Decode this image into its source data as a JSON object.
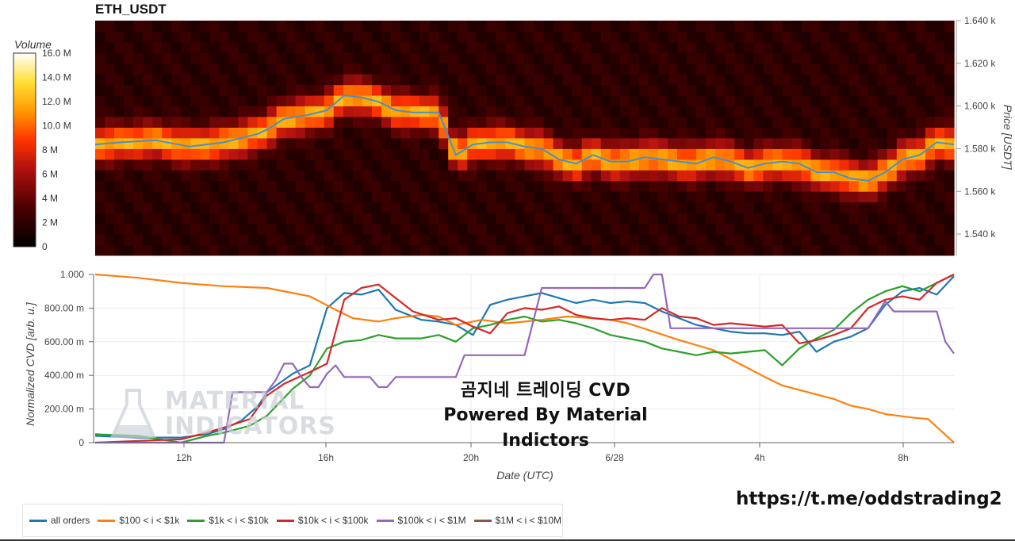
{
  "title": "ETH_USDT",
  "overlay": {
    "line1": "곰지네 트레이딩 CVD",
    "line2": "Powered By Material Indictors"
  },
  "link": "https://t.me/oddstrading2",
  "watermark": {
    "line1": "MATERIAL",
    "line2": "INDICATORS"
  },
  "colors": {
    "all": "#1f77b4",
    "s100": "#ff7f0e",
    "s1k": "#2ca02c",
    "s10k": "#d62728",
    "s100k": "#9467bd",
    "s1m": "#8c564b",
    "price_line": "#4a90c8"
  },
  "chart_data": [
    {
      "type": "heatmap",
      "title": "ETH_USDT",
      "colorbar_label": "Volume",
      "colorbar_ticks": [
        "16.0 M",
        "14.0 M",
        "12.0 M",
        "10.0 M",
        "8 M",
        "6 M",
        "4 M",
        "2 M",
        "0"
      ],
      "colorbar_values": [
        16,
        14,
        12,
        10,
        8,
        6,
        4,
        2,
        0
      ],
      "ylabel": "Price [USDT]",
      "ylim": [
        1530,
        1640
      ],
      "yticks": [
        "1.540 k",
        "1.560 k",
        "1.580 k",
        "1.600 k",
        "1.620 k",
        "1.640 k"
      ],
      "ytick_values": [
        1540,
        1560,
        1580,
        1600,
        1620,
        1640
      ],
      "price_line": {
        "x": [
          0.0,
          0.03,
          0.07,
          0.11,
          0.15,
          0.19,
          0.2,
          0.22,
          0.25,
          0.27,
          0.29,
          0.31,
          0.33,
          0.35,
          0.37,
          0.4,
          0.42,
          0.44,
          0.46,
          0.48,
          0.5,
          0.52,
          0.54,
          0.56,
          0.58,
          0.6,
          0.62,
          0.64,
          0.66,
          0.68,
          0.7,
          0.72,
          0.74,
          0.76,
          0.78,
          0.8,
          0.82,
          0.84,
          0.86,
          0.88,
          0.9,
          0.92,
          0.94,
          0.96,
          0.98,
          1.0
        ],
        "y": [
          1582,
          1583,
          1584,
          1581,
          1583,
          1587,
          1589,
          1594,
          1596,
          1598,
          1605,
          1604,
          1602,
          1598,
          1597,
          1597,
          1577,
          1582,
          1583,
          1583,
          1581,
          1580,
          1575,
          1573,
          1577,
          1574,
          1574,
          1576,
          1575,
          1574,
          1573,
          1576,
          1574,
          1571,
          1573,
          1574,
          1573,
          1569,
          1569,
          1566,
          1565,
          1569,
          1575,
          1577,
          1583,
          1582
        ]
      }
    },
    {
      "type": "line",
      "ylabel": "Normalized CVD [arb. u.]",
      "xlabel": "Date (UTC)",
      "ylim": [
        0,
        1
      ],
      "yticks": [
        "0",
        "200.00 m",
        "400.00 m",
        "600.00 m",
        "800.00 m",
        "1.000"
      ],
      "ytick_values": [
        0,
        0.2,
        0.4,
        0.6,
        0.8,
        1.0
      ],
      "xticks": [
        "12h",
        "16h",
        "20h",
        "6/28",
        "4h",
        "8h"
      ],
      "xtick_values": [
        0.1323,
        0.3372,
        0.5419,
        0.7465,
        0.9507,
        1.1555
      ],
      "x_range_note": "",
      "series": [
        {
          "name": "all orders",
          "key": "all",
          "x": [
            0.0,
            0.05,
            0.1,
            0.13,
            0.15,
            0.17,
            0.19,
            0.2,
            0.23,
            0.25,
            0.27,
            0.29,
            0.31,
            0.33,
            0.35,
            0.37,
            0.38,
            0.4,
            0.42,
            0.44,
            0.46,
            0.48,
            0.5,
            0.52,
            0.54,
            0.56,
            0.58,
            0.6,
            0.62,
            0.64,
            0.66,
            0.68,
            0.7,
            0.72,
            0.74,
            0.76,
            0.78,
            0.8,
            0.82,
            0.84,
            0.86,
            0.88,
            0.9,
            0.92,
            0.94,
            0.96,
            0.98,
            1.0
          ],
          "y": [
            0.04,
            0.03,
            0.03,
            0.05,
            0.08,
            0.13,
            0.22,
            0.3,
            0.41,
            0.46,
            0.8,
            0.89,
            0.88,
            0.91,
            0.79,
            0.75,
            0.73,
            0.72,
            0.7,
            0.64,
            0.82,
            0.85,
            0.87,
            0.89,
            0.86,
            0.83,
            0.85,
            0.83,
            0.84,
            0.83,
            0.78,
            0.74,
            0.7,
            0.68,
            0.66,
            0.65,
            0.65,
            0.64,
            0.66,
            0.54,
            0.6,
            0.63,
            0.68,
            0.82,
            0.9,
            0.92,
            0.88,
            0.99
          ]
        },
        {
          "name": "$100 < i < $1k",
          "key": "s100",
          "x": [
            0.0,
            0.05,
            0.1,
            0.15,
            0.2,
            0.25,
            0.28,
            0.3,
            0.33,
            0.35,
            0.38,
            0.4,
            0.42,
            0.45,
            0.48,
            0.5,
            0.52,
            0.55,
            0.58,
            0.6,
            0.62,
            0.65,
            0.68,
            0.7,
            0.72,
            0.75,
            0.78,
            0.8,
            0.83,
            0.86,
            0.88,
            0.9,
            0.92,
            0.95,
            0.97,
            1.0
          ],
          "y": [
            1.0,
            0.98,
            0.95,
            0.93,
            0.92,
            0.87,
            0.79,
            0.74,
            0.72,
            0.74,
            0.76,
            0.75,
            0.7,
            0.73,
            0.71,
            0.72,
            0.73,
            0.75,
            0.74,
            0.73,
            0.71,
            0.66,
            0.61,
            0.58,
            0.55,
            0.47,
            0.39,
            0.34,
            0.3,
            0.26,
            0.22,
            0.2,
            0.17,
            0.15,
            0.14,
            0.0
          ]
        },
        {
          "name": "$1k < i < $10k",
          "key": "s1k",
          "x": [
            0.0,
            0.05,
            0.1,
            0.13,
            0.15,
            0.18,
            0.2,
            0.23,
            0.25,
            0.27,
            0.29,
            0.31,
            0.33,
            0.35,
            0.38,
            0.4,
            0.42,
            0.44,
            0.46,
            0.48,
            0.5,
            0.52,
            0.54,
            0.56,
            0.58,
            0.6,
            0.62,
            0.64,
            0.66,
            0.68,
            0.7,
            0.72,
            0.74,
            0.76,
            0.78,
            0.8,
            0.82,
            0.84,
            0.86,
            0.88,
            0.9,
            0.92,
            0.94,
            0.96,
            0.98,
            1.0
          ],
          "y": [
            0.05,
            0.04,
            0.0,
            0.04,
            0.06,
            0.1,
            0.16,
            0.32,
            0.4,
            0.56,
            0.6,
            0.61,
            0.64,
            0.62,
            0.62,
            0.64,
            0.6,
            0.68,
            0.7,
            0.73,
            0.75,
            0.72,
            0.73,
            0.71,
            0.68,
            0.64,
            0.62,
            0.6,
            0.56,
            0.54,
            0.52,
            0.54,
            0.53,
            0.54,
            0.55,
            0.46,
            0.56,
            0.62,
            0.67,
            0.77,
            0.85,
            0.9,
            0.93,
            0.9,
            0.95,
            1.0
          ]
        },
        {
          "name": "$10k < i < $100k",
          "key": "s10k",
          "x": [
            0.0,
            0.05,
            0.1,
            0.13,
            0.15,
            0.18,
            0.2,
            0.22,
            0.25,
            0.27,
            0.29,
            0.31,
            0.33,
            0.35,
            0.37,
            0.4,
            0.42,
            0.44,
            0.46,
            0.48,
            0.5,
            0.52,
            0.54,
            0.56,
            0.58,
            0.6,
            0.62,
            0.64,
            0.66,
            0.68,
            0.7,
            0.72,
            0.74,
            0.76,
            0.78,
            0.8,
            0.82,
            0.84,
            0.86,
            0.88,
            0.9,
            0.92,
            0.94,
            0.96,
            0.98,
            1.0
          ],
          "y": [
            0.0,
            0.01,
            0.02,
            0.06,
            0.09,
            0.14,
            0.28,
            0.35,
            0.42,
            0.47,
            0.85,
            0.92,
            0.94,
            0.86,
            0.78,
            0.73,
            0.74,
            0.69,
            0.65,
            0.77,
            0.8,
            0.79,
            0.81,
            0.76,
            0.74,
            0.73,
            0.74,
            0.73,
            0.8,
            0.75,
            0.74,
            0.7,
            0.71,
            0.7,
            0.69,
            0.7,
            0.59,
            0.61,
            0.64,
            0.68,
            0.8,
            0.85,
            0.87,
            0.85,
            0.95,
            1.0
          ]
        },
        {
          "name": "$100k < i < $1M",
          "key": "s100k",
          "x": [
            0.0,
            0.15,
            0.16,
            0.17,
            0.18,
            0.2,
            0.21,
            0.22,
            0.23,
            0.24,
            0.25,
            0.26,
            0.27,
            0.28,
            0.29,
            0.3,
            0.31,
            0.32,
            0.33,
            0.34,
            0.35,
            0.36,
            0.37,
            0.38,
            0.39,
            0.4,
            0.42,
            0.43,
            0.44,
            0.45,
            0.46,
            0.47,
            0.5,
            0.52,
            0.54,
            0.56,
            0.57,
            0.6,
            0.62,
            0.64,
            0.65,
            0.66,
            0.67,
            0.68,
            0.7,
            0.72,
            0.74,
            0.76,
            0.78,
            0.8,
            0.82,
            0.84,
            0.86,
            0.88,
            0.9,
            0.92,
            0.93,
            0.95,
            0.96,
            0.97,
            0.98,
            0.99,
            1.0
          ],
          "y": [
            0.0,
            0.0,
            0.3,
            0.3,
            0.3,
            0.3,
            0.37,
            0.47,
            0.47,
            0.39,
            0.33,
            0.33,
            0.41,
            0.46,
            0.39,
            0.39,
            0.39,
            0.39,
            0.33,
            0.33,
            0.39,
            0.39,
            0.39,
            0.39,
            0.39,
            0.39,
            0.39,
            0.52,
            0.52,
            0.52,
            0.52,
            0.52,
            0.52,
            0.92,
            0.92,
            0.92,
            0.92,
            0.92,
            0.92,
            0.92,
            1.0,
            1.0,
            0.68,
            0.68,
            0.68,
            0.68,
            0.68,
            0.68,
            0.68,
            0.68,
            0.68,
            0.68,
            0.68,
            0.68,
            0.68,
            0.84,
            0.78,
            0.78,
            0.78,
            0.78,
            0.78,
            0.6,
            0.53
          ]
        },
        {
          "name": "$1M < i < $10M",
          "key": "s1m",
          "x": [],
          "y": []
        }
      ]
    }
  ]
}
